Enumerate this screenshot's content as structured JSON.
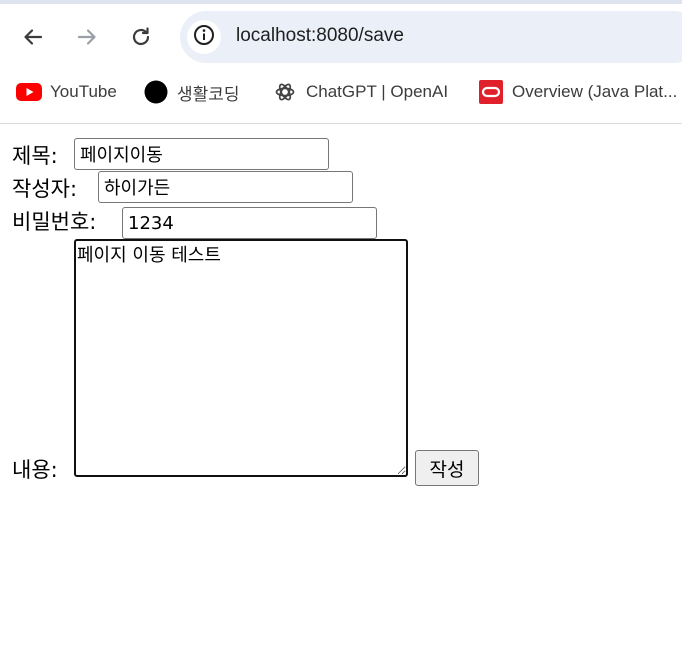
{
  "browser": {
    "url": "localhost:8080/save",
    "icons": [
      "back-arrow-icon",
      "forward-arrow-icon",
      "reload-icon",
      "site-info-icon"
    ],
    "bookmarks": [
      {
        "label": "YouTube",
        "icon": "youtube-icon",
        "color": "#ff0000"
      },
      {
        "label": "생활코딩",
        "icon": "black-circle-icon",
        "color": "#000000"
      },
      {
        "label": "ChatGPT | OpenAI",
        "icon": "openai-icon",
        "color": "#444444"
      },
      {
        "label": "Overview (Java Plat...",
        "icon": "oracle-icon",
        "color": "#e0202a"
      }
    ]
  },
  "form": {
    "title_label": "제목:",
    "title_value": "페이지이동",
    "writer_label": "작성자:",
    "writer_value": "하이가든",
    "password_label": "비밀번호:",
    "password_value": "1234",
    "content_label": "내용:",
    "content_value": "페이지 이동 테스트",
    "submit_label": "작성"
  }
}
